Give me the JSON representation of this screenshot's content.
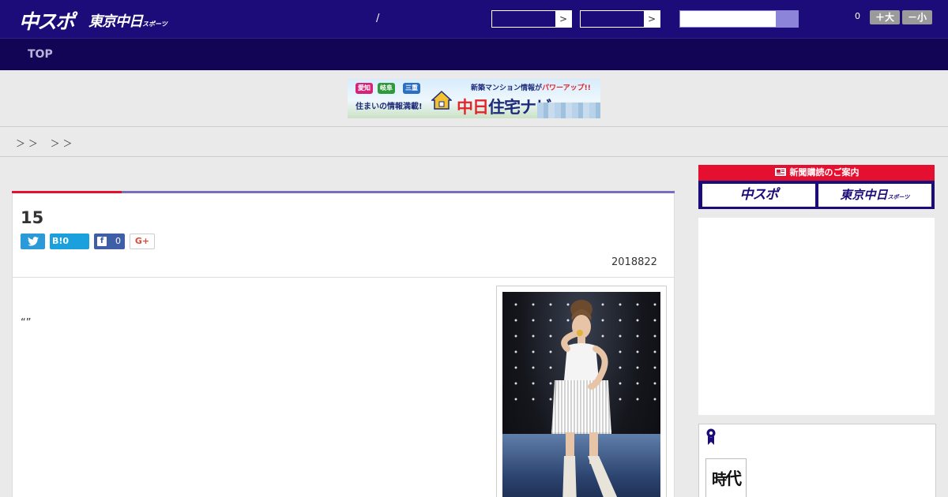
{
  "header": {
    "brand_chuspo": "中スポ",
    "brand_tokyo": "東京中日",
    "brand_tokyo_small": "スポーツ",
    "separator": "/",
    "select1_arrow": ">",
    "select2_arrow": ">",
    "notification_count": "0",
    "font_larger": "＋大",
    "font_smaller": "－小"
  },
  "nav": {
    "top_label": "TOP"
  },
  "banner": {
    "tags": [
      "愛知",
      "岐阜",
      "三重"
    ],
    "subtitle": "住まいの情報満載!",
    "tagline_prefix": "新築マンション情報が",
    "tagline_highlight": "パワーアップ!!",
    "logo_red": "中日",
    "logo_blue": "住宅ナビ"
  },
  "breadcrumb": {
    "text": "＞ ＞ 　＞ ＞"
  },
  "article": {
    "title": "15",
    "hatena_label": "B!0",
    "facebook_count": "0",
    "gplus_label": "G+",
    "twitter_icon": "t",
    "date": "2018822",
    "body_quote": "“”"
  },
  "sidebar": {
    "subscribe_heading": "新聞購読のご案内",
    "subscribe_chuspo": "中スポ",
    "subscribe_tokyo": "東京中日",
    "subscribe_tokyo_small": "スポーツ",
    "jidai_label_1": "時",
    "jidai_label_2": "代"
  },
  "colors": {
    "header_bg": "#1c0c7a",
    "nav_bg": "#120555",
    "accent_red": "#e5102f",
    "accent_purple": "#7a6dbd",
    "search_button": "#8c84d8"
  }
}
